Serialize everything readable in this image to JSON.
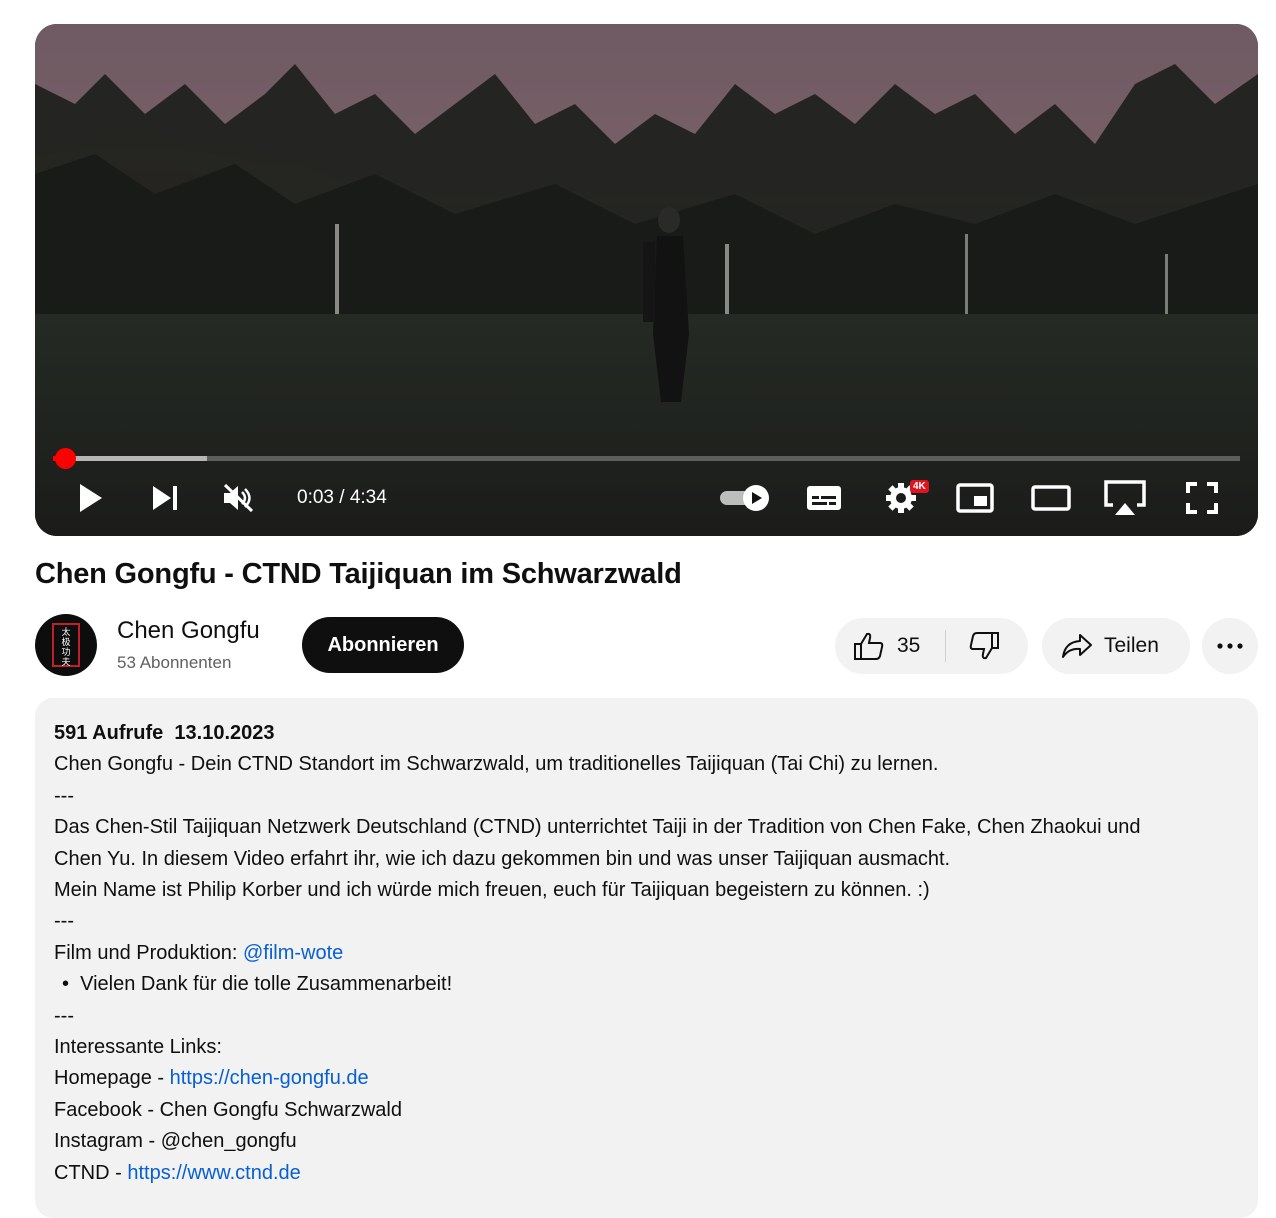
{
  "player": {
    "time_current": "0:03",
    "time_separator": " / ",
    "time_total": "4:34",
    "progress_fraction": 0.01,
    "buffered_fraction": 0.13,
    "quality_badge": "4K",
    "icons": [
      "play-icon",
      "next-icon",
      "mute-icon",
      "autoplay-toggle-icon",
      "subtitles-icon",
      "settings-icon",
      "miniplayer-icon",
      "theater-mode-icon",
      "airplay-icon",
      "fullscreen-icon"
    ],
    "accent_color": "#ff0000"
  },
  "video": {
    "title": "Chen Gongfu - CTND Taijiquan im Schwarzwald"
  },
  "channel": {
    "name": "Chen Gongfu",
    "subscribers": "53 Abonnenten",
    "subscribe_label": "Abonnieren",
    "avatar_logo_text": "太极功夫"
  },
  "actions": {
    "like_count": "35",
    "share_label": "Teilen"
  },
  "description": {
    "views": "591 Aufrufe",
    "date": "13.10.2023",
    "line1": "Chen Gongfu - Dein CTND Standort im Schwarzwald, um traditionelles Taijiquan (Tai Chi) zu lernen.",
    "sep1": "---",
    "line2a": "Das Chen-Stil Taijiquan Netzwerk Deutschland (CTND) unterrichtet Taiji in der Tradition von Chen Fake, Chen Zhaokui und",
    "line2b": "Chen Yu. In diesem Video erfahrt ihr, wie ich dazu gekommen bin und was unser Taijiquan ausmacht.",
    "line3": "Mein Name ist Philip Korber und ich würde mich freuen, euch für Taijiquan begeistern zu können. :)",
    "sep2": "---",
    "film_label": "Film und Produktion: ",
    "film_link": "@film-wote",
    "bullet": "Vielen Dank für die tolle Zusammenarbeit!",
    "sep3": "---",
    "links_heading": "Interessante Links:",
    "homepage_label": "Homepage - ",
    "homepage_link": "https://chen-gongfu.de",
    "facebook": "Facebook - Chen Gongfu Schwarzwald",
    "instagram": "Instagram - @chen_gongfu",
    "ctnd_label": "CTND - ",
    "ctnd_link": "https://www.ctnd.de"
  }
}
